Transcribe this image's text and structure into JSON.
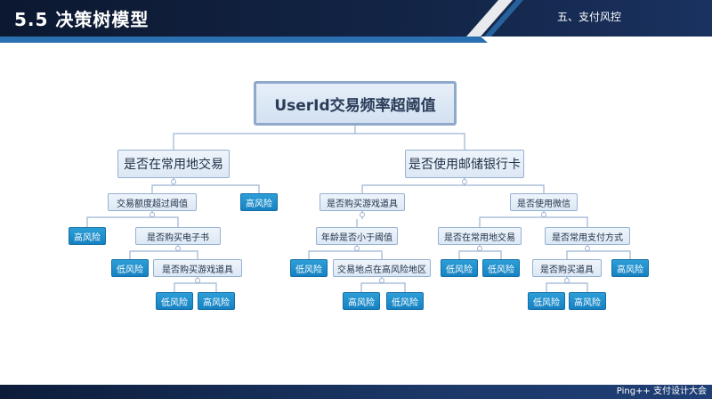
{
  "header": {
    "title": "5.5  决策树模型",
    "section": "五、支付风控"
  },
  "footer": {
    "brand": "Ping++ 支付设计大会"
  },
  "colors": {
    "header_dark": "#0f1c36",
    "accent_blue": "#1f80c4",
    "node_fill": "#dde8f5",
    "leaf_fill": "#1f8fcf"
  },
  "tree": {
    "root": "UserId交易频率超阈值",
    "left": {
      "label": "是否在常用地交易",
      "amount": "交易额度超过阈值",
      "high_risk": "高风险",
      "amount_high": "高风险",
      "ebook": "是否购买电子书",
      "ebook_low": "低风险",
      "game": "是否购买游戏道具",
      "game_low": "低风险",
      "game_high": "高风险"
    },
    "right": {
      "label": "是否使用邮储银行卡",
      "game": {
        "label": "是否购买游戏道具",
        "age": "年龄是否小于阈值",
        "age_low": "低风险",
        "location": "交易地点在高风险地区",
        "loc_high": "高风险",
        "loc_low": "低风险"
      },
      "wechat": {
        "label": "是否使用微信",
        "common_place": "是否在常用地交易",
        "place_low1": "低风险",
        "place_low2": "低风险",
        "common_pay": "是否常用支付方式",
        "buy_item": "是否购买道具",
        "item_low": "低风险",
        "item_high": "高风险",
        "pay_high": "高风险"
      }
    }
  }
}
